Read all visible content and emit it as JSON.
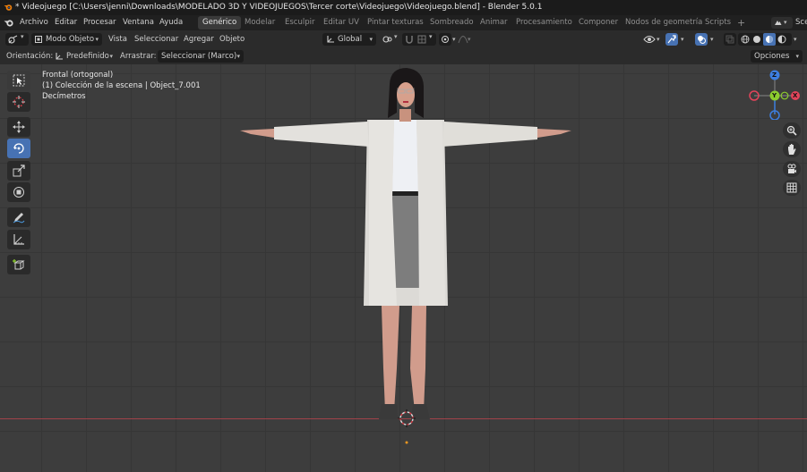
{
  "window": {
    "title": "* Videojuego [C:\\Users\\jenni\\Downloads\\MODELADO 3D Y VIDEOJUEGOS\\Tercer corte\\Videojuego\\Videojuego.blend] - Blender 5.0.1"
  },
  "menu": {
    "items": [
      "Archivo",
      "Editar",
      "Procesar",
      "Ventana",
      "Ayuda"
    ]
  },
  "workspaces": {
    "tabs": [
      "Genérico",
      "Modelar",
      "Esculpir",
      "Editar UV",
      "Pintar texturas",
      "Sombreado",
      "Animar",
      "Procesamiento",
      "Componer",
      "Nodos de geometría",
      "Scripts"
    ],
    "add": "+",
    "scene_label": "Sce"
  },
  "header": {
    "mode": "Modo Objeto",
    "menus": [
      "Vista",
      "Seleccionar",
      "Agregar",
      "Objeto"
    ],
    "transform_orientation": "Global"
  },
  "tool_header": {
    "orientation_label": "Orientación:",
    "orientation_value": "Predefinido",
    "drag_label": "Arrastrar:",
    "drag_value": "Seleccionar (Marco)",
    "options": "Opciones"
  },
  "viewport": {
    "view_name": "Frontal (ortogonal)",
    "collection": "(1) Colección de la escena | Object_7.001",
    "units": "Decímetros"
  },
  "gizmo": {
    "z": "Z",
    "y": "Y",
    "x": "X"
  },
  "colors": {
    "accent": "#4772b3",
    "x_axis": "#e2445a",
    "y_axis": "#8ccc2e",
    "z_axis": "#3d7ee0"
  }
}
